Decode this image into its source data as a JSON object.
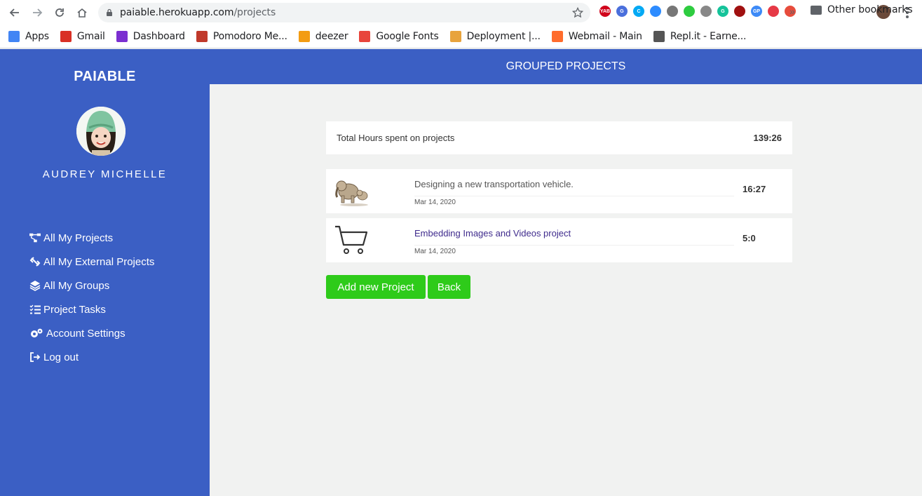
{
  "browser": {
    "url_host": "paiable.herokuapp.com",
    "url_path": "/projects",
    "bookmarks": [
      {
        "label": "Apps",
        "icon": "apps-grid-icon",
        "color": "#4285f4"
      },
      {
        "label": "Gmail",
        "icon": "gmail-icon",
        "color": "#d93025"
      },
      {
        "label": "Dashboard",
        "icon": "dashboard-icon",
        "color": "#7b2fd0"
      },
      {
        "label": "Pomodoro Me...",
        "icon": "pomodoro-icon",
        "color": "#c0392b"
      },
      {
        "label": "deezer",
        "icon": "deezer-icon",
        "color": "#f39c12"
      },
      {
        "label": "Google Fonts",
        "icon": "google-fonts-icon",
        "color": "#e8453c"
      },
      {
        "label": "Deployment |...",
        "icon": "deployment-icon",
        "color": "#e8a33c"
      },
      {
        "label": "Webmail - Main",
        "icon": "cpanel-icon",
        "color": "#ff6c2c"
      },
      {
        "label": "Repl.it - Earne...",
        "icon": "replit-icon",
        "color": "#555555"
      }
    ],
    "bookmarks_more": "»",
    "other_bookmarks": "Other bookmarks",
    "extensions": [
      {
        "name": "yab-ext-icon",
        "color": "#d0021b",
        "text": "YAB"
      },
      {
        "name": "translate-ext-icon",
        "color": "#4a6fdc",
        "text": "G"
      },
      {
        "name": "clockify-ext-icon",
        "color": "#03a9f4",
        "text": "C"
      },
      {
        "name": "zoom-ext-icon",
        "color": "#2d8cff",
        "text": ""
      },
      {
        "name": "bug-ext-icon",
        "color": "#777777",
        "text": ""
      },
      {
        "name": "shield-ext-icon",
        "color": "#2ecc40",
        "text": ""
      },
      {
        "name": "tomato-ext-icon",
        "color": "#888888",
        "text": ""
      },
      {
        "name": "grammarly-ext-icon",
        "color": "#15c39a",
        "text": "G"
      },
      {
        "name": "audio-ext-icon",
        "color": "#a01010",
        "text": ""
      },
      {
        "name": "gp-ext-icon",
        "color": "#3d8af7",
        "text": "GP"
      },
      {
        "name": "lastpass-ext-icon",
        "color": "#e63946",
        "text": ""
      },
      {
        "name": "sitemap-ext-icon",
        "color": "#e74c3c",
        "text": ""
      }
    ]
  },
  "sidebar": {
    "brand": "PAIABLE",
    "username": "AUDREY MICHELLE",
    "items": [
      {
        "label": "All My Projects",
        "icon": "sitemap-icon"
      },
      {
        "label": "All My External Projects",
        "icon": "unlink-icon"
      },
      {
        "label": "All My Groups",
        "icon": "layers-icon"
      },
      {
        "label": "Project Tasks",
        "icon": "tasks-list-icon"
      },
      {
        "label": "Account Settings",
        "icon": "gears-icon"
      },
      {
        "label": "Log out",
        "icon": "sign-out-icon"
      }
    ]
  },
  "header": {
    "title": "GROUPED PROJECTS"
  },
  "main": {
    "total_label": "Total Hours spent on projects",
    "total_value": "139:26",
    "projects": [
      {
        "title": "Designing a new transportation vehicle.",
        "date": "Mar 14, 2020",
        "hours": "16:27",
        "thumb": "elephant-image"
      },
      {
        "title": "Embedding Images and Videos project",
        "date": "Mar 14, 2020",
        "hours": "5:0",
        "thumb": "cart-icon"
      }
    ],
    "add_button": "Add new Project",
    "back_button": "Back"
  },
  "colors": {
    "sidebar_bg": "#3b5fc4",
    "button_green": "#2ecb1a",
    "main_bg": "#f1f2f1"
  }
}
